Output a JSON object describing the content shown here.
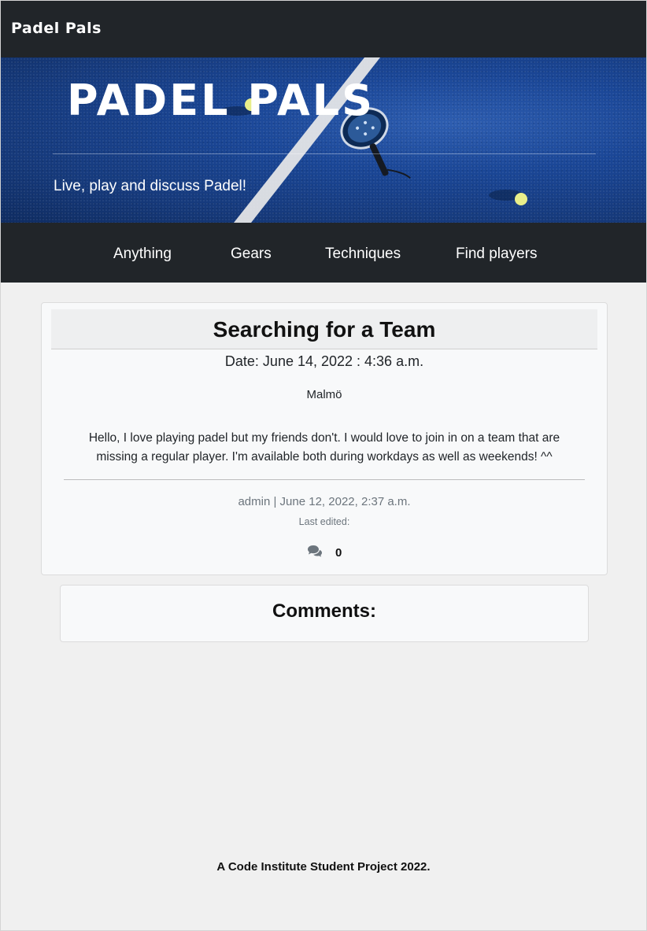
{
  "navbar": {
    "brand": "Padel Pals"
  },
  "hero": {
    "title": "PADEL PALS",
    "subtitle": "Live, play and discuss Padel!"
  },
  "categories": [
    {
      "label": "Anything"
    },
    {
      "label": "Gears"
    },
    {
      "label": "Techniques"
    },
    {
      "label": "Find players"
    }
  ],
  "post": {
    "title": "Searching for a Team",
    "date": "Date: June 14, 2022 : 4:36 a.m.",
    "location": "Malmö",
    "body": "Hello, I love playing padel but my friends don't. I would love to join in on a team that are missing a regular player. I'm available both during workdays as well as weekends! ^^",
    "meta": "admin | June 12, 2022, 2:37 a.m.",
    "last_edited": "Last edited:",
    "comment_count": "0",
    "comment_icon": "comments-icon"
  },
  "comments": {
    "title": "Comments:"
  },
  "footer": {
    "text": "A Code Institute Student Project 2022."
  },
  "colors": {
    "navbar_bg": "#212529",
    "page_bg": "#f0f0f0",
    "card_bg": "#f8f9fa",
    "hero_blue": "#1a4696"
  }
}
